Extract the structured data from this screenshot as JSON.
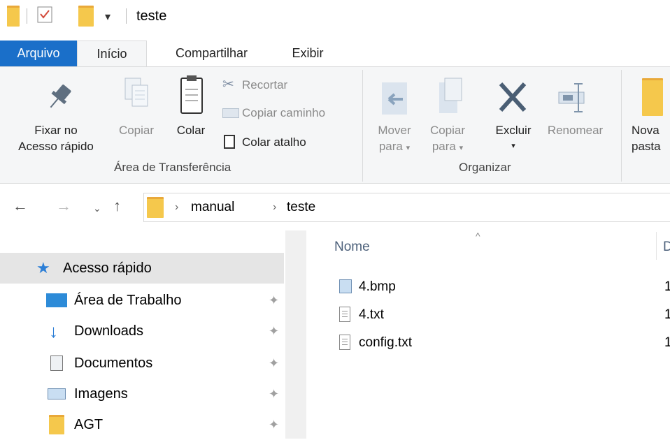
{
  "window": {
    "title": "teste"
  },
  "tabs": [
    {
      "label": "Arquivo"
    },
    {
      "label": "Início"
    },
    {
      "label": "Compartilhar"
    },
    {
      "label": "Exibir"
    }
  ],
  "ribbon": {
    "clipboard": {
      "pin_label_line1": "Fixar no",
      "pin_label_line2": "Acesso rápido",
      "copy": "Copiar",
      "paste": "Colar",
      "cut": "Recortar",
      "copy_path": "Copiar caminho",
      "paste_shortcut": "Colar atalho",
      "group_label": "Área de Transferência"
    },
    "organize": {
      "move_line1": "Mover",
      "move_line2": "para",
      "copy_line1": "Copiar",
      "copy_line2": "para",
      "delete": "Excluir",
      "rename": "Renomear",
      "group_label": "Organizar"
    },
    "new": {
      "new_folder_line1": "Nova",
      "new_folder_line2": "pasta"
    }
  },
  "address": {
    "crumbs": [
      "manual",
      "teste"
    ]
  },
  "nav_pane": {
    "quick_access": "Acesso rápido",
    "items": [
      {
        "label": "Área de Trabalho"
      },
      {
        "label": "Downloads"
      },
      {
        "label": "Documentos"
      },
      {
        "label": "Imagens"
      },
      {
        "label": "AGT"
      }
    ]
  },
  "file_list": {
    "columns": {
      "name": "Nome",
      "date_partial": "D"
    },
    "files": [
      {
        "name": "4.bmp",
        "icon": "bitmap-icon",
        "date_partial": "1"
      },
      {
        "name": "4.txt",
        "icon": "text-file-icon",
        "date_partial": "1"
      },
      {
        "name": "config.txt",
        "icon": "text-file-icon",
        "date_partial": "1"
      }
    ]
  },
  "colors": {
    "accent": "#1a6fc9",
    "folder": "#f5c84c",
    "selection": "#e5e5e5",
    "ribbon_bg": "#f5f6f7"
  }
}
